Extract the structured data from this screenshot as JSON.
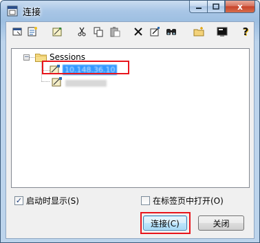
{
  "window": {
    "title": "连接",
    "close_glyph": "x"
  },
  "toolbar": {
    "buttons": [
      {
        "name": "connect-icon"
      },
      {
        "name": "new-session-icon"
      },
      {
        "name": "properties-icon"
      },
      {
        "name": "cut-icon"
      },
      {
        "name": "copy-icon"
      },
      {
        "name": "paste-icon"
      },
      {
        "name": "delete-icon"
      },
      {
        "name": "edit-icon"
      },
      {
        "name": "find-icon"
      },
      {
        "name": "new-folder-icon"
      },
      {
        "name": "terminal-icon"
      },
      {
        "name": "help-icon"
      }
    ]
  },
  "tree": {
    "root": {
      "label": "Sessions",
      "expander": "−"
    },
    "items": [
      {
        "label": "10.148.36.10",
        "selected": true
      },
      {
        "label": "",
        "selected": false
      }
    ]
  },
  "options": {
    "show_on_startup": {
      "label": "启动时显示(S)",
      "checked": true,
      "mark": "✓"
    },
    "open_in_tab": {
      "label": "在标签页中打开(O)",
      "checked": false
    }
  },
  "buttons": {
    "connect": "连接(C)",
    "close": "关闭"
  },
  "colors": {
    "highlight": "#e8141b",
    "selection": "#3399ff"
  }
}
